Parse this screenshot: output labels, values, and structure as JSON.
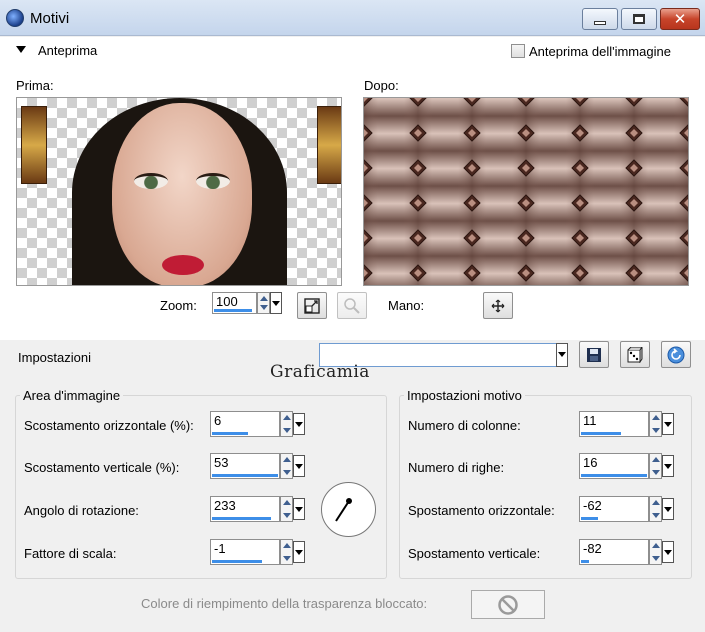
{
  "window": {
    "title": "Motivi",
    "minimize_icon": "minimize-icon",
    "maximize_icon": "maximize-icon",
    "close_icon": "close-icon"
  },
  "preview": {
    "section_label": "Anteprima",
    "image_preview_checkbox_label": "Anteprima dell'immagine",
    "image_preview_checked": false,
    "before_label": "Prima:",
    "after_label": "Dopo:"
  },
  "zoom": {
    "label": "Zoom:",
    "value": "100",
    "pan_label": "Mano:"
  },
  "settings": {
    "label": "Impostazioni",
    "preset_value": "",
    "watermark": "Graficamia"
  },
  "image_area": {
    "title": "Area d'immagine",
    "fields": [
      {
        "label": "Scostamento orizzontale (%):",
        "value": "6",
        "level": 0.55
      },
      {
        "label": "Scostamento verticale (%):",
        "value": "53",
        "level": 1.0
      },
      {
        "label": "Angolo di rotazione:",
        "value": "233",
        "level": 0.9
      },
      {
        "label": "Fattore di scala:",
        "value": "-1",
        "level": 0.75
      }
    ]
  },
  "pattern_settings": {
    "title": "Impostazioni motivo",
    "fields": [
      {
        "label": "Numero di colonne:",
        "value": "11",
        "level": 0.6
      },
      {
        "label": "Numero di righe:",
        "value": "16",
        "level": 1.0
      },
      {
        "label": "Spostamento orizzontale:",
        "value": "-62",
        "level": 0.25
      },
      {
        "label": "Spostamento verticale:",
        "value": "-82",
        "level": 0.12
      }
    ]
  },
  "transparency": {
    "label": "Colore di riempimento della trasparenza bloccato:"
  },
  "colors": {
    "accent": "#3d8ee8",
    "titlebar": "#c4d5ec",
    "close": "#c7442a"
  }
}
